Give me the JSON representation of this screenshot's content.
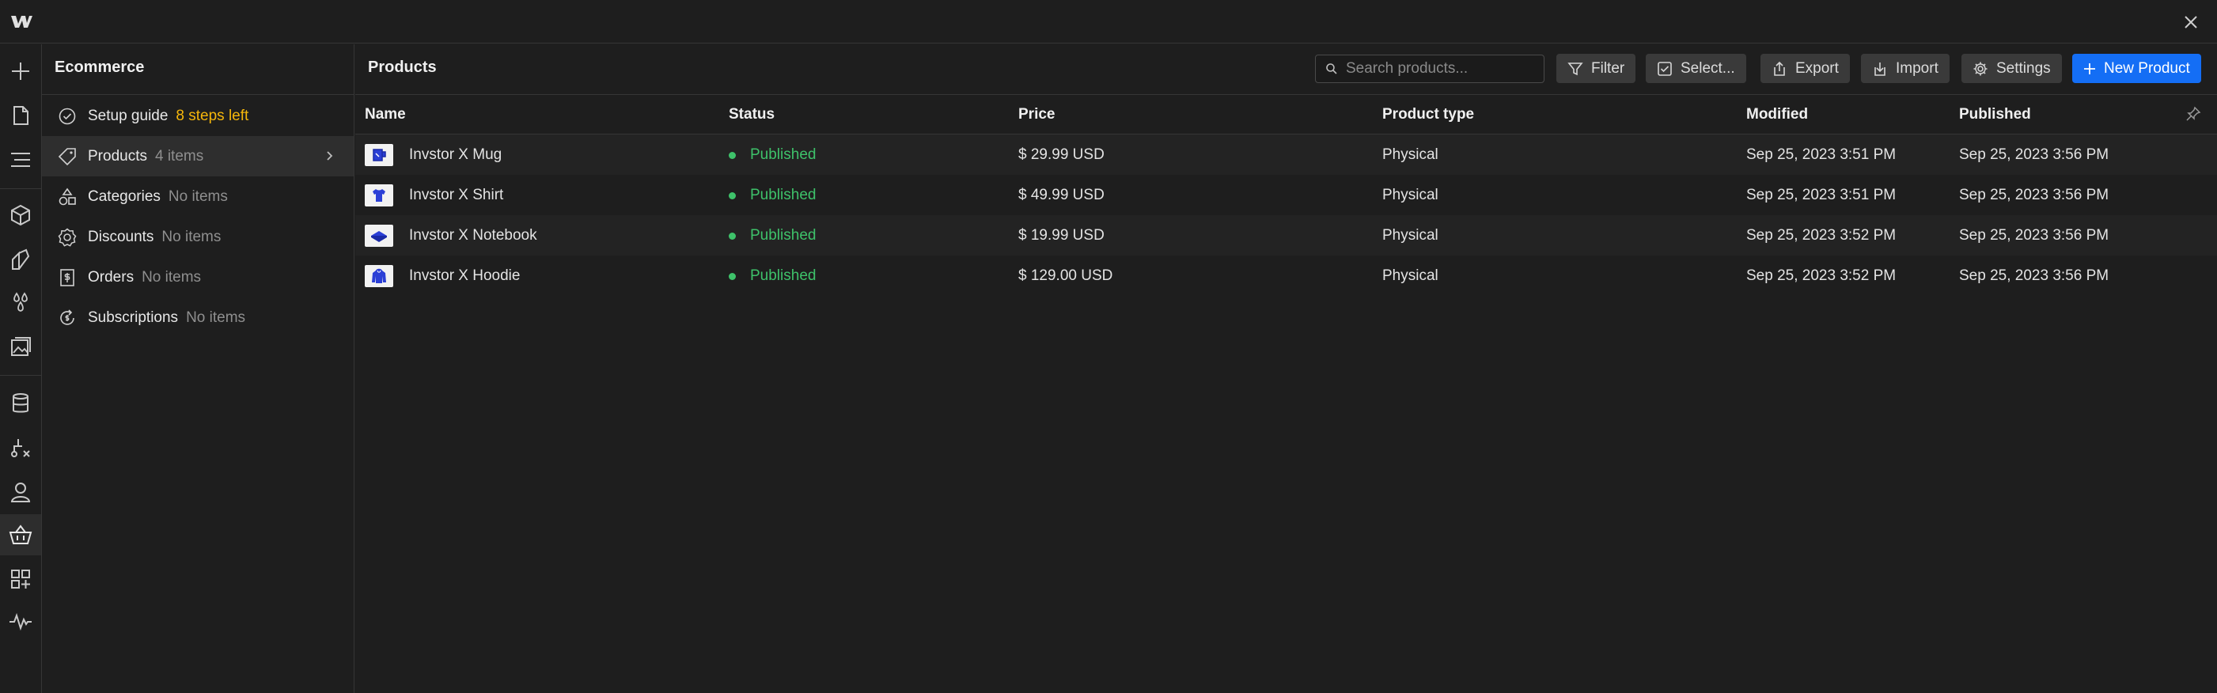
{
  "colors": {
    "accent": "#146ef5",
    "published": "#3ec26a",
    "warning": "#f5b60b"
  },
  "sidebar": {
    "title": "Ecommerce",
    "items": [
      {
        "label": "Setup guide",
        "meta": "8 steps left",
        "icon": "check-circle-icon"
      },
      {
        "label": "Products",
        "meta": "4 items",
        "icon": "tag-icon"
      },
      {
        "label": "Categories",
        "meta": "No items",
        "icon": "shapes-icon"
      },
      {
        "label": "Discounts",
        "meta": "No items",
        "icon": "discount-badge-icon"
      },
      {
        "label": "Orders",
        "meta": "No items",
        "icon": "receipt-icon"
      },
      {
        "label": "Subscriptions",
        "meta": "No items",
        "icon": "subscription-icon"
      }
    ]
  },
  "main": {
    "title": "Products",
    "search_placeholder": "Search products...",
    "buttons": {
      "filter": "Filter",
      "select": "Select...",
      "export": "Export",
      "import": "Import",
      "settings": "Settings",
      "new_product": "New Product"
    }
  },
  "table": {
    "columns": [
      "Name",
      "Status",
      "Price",
      "Product type",
      "Modified",
      "Published"
    ],
    "rows": [
      {
        "name": "Invstor X Mug",
        "status": "Published",
        "price": "$ 29.99 USD",
        "type": "Physical",
        "modified": "Sep 25, 2023 3:51 PM",
        "published": "Sep 25, 2023 3:56 PM"
      },
      {
        "name": "Invstor X Shirt",
        "status": "Published",
        "price": "$ 49.99 USD",
        "type": "Physical",
        "modified": "Sep 25, 2023 3:51 PM",
        "published": "Sep 25, 2023 3:56 PM"
      },
      {
        "name": "Invstor X Notebook",
        "status": "Published",
        "price": "$ 19.99 USD",
        "type": "Physical",
        "modified": "Sep 25, 2023 3:52 PM",
        "published": "Sep 25, 2023 3:56 PM"
      },
      {
        "name": "Invstor X Hoodie",
        "status": "Published",
        "price": "$ 129.00 USD",
        "type": "Physical",
        "modified": "Sep 25, 2023 3:52 PM",
        "published": "Sep 25, 2023 3:56 PM"
      }
    ]
  }
}
